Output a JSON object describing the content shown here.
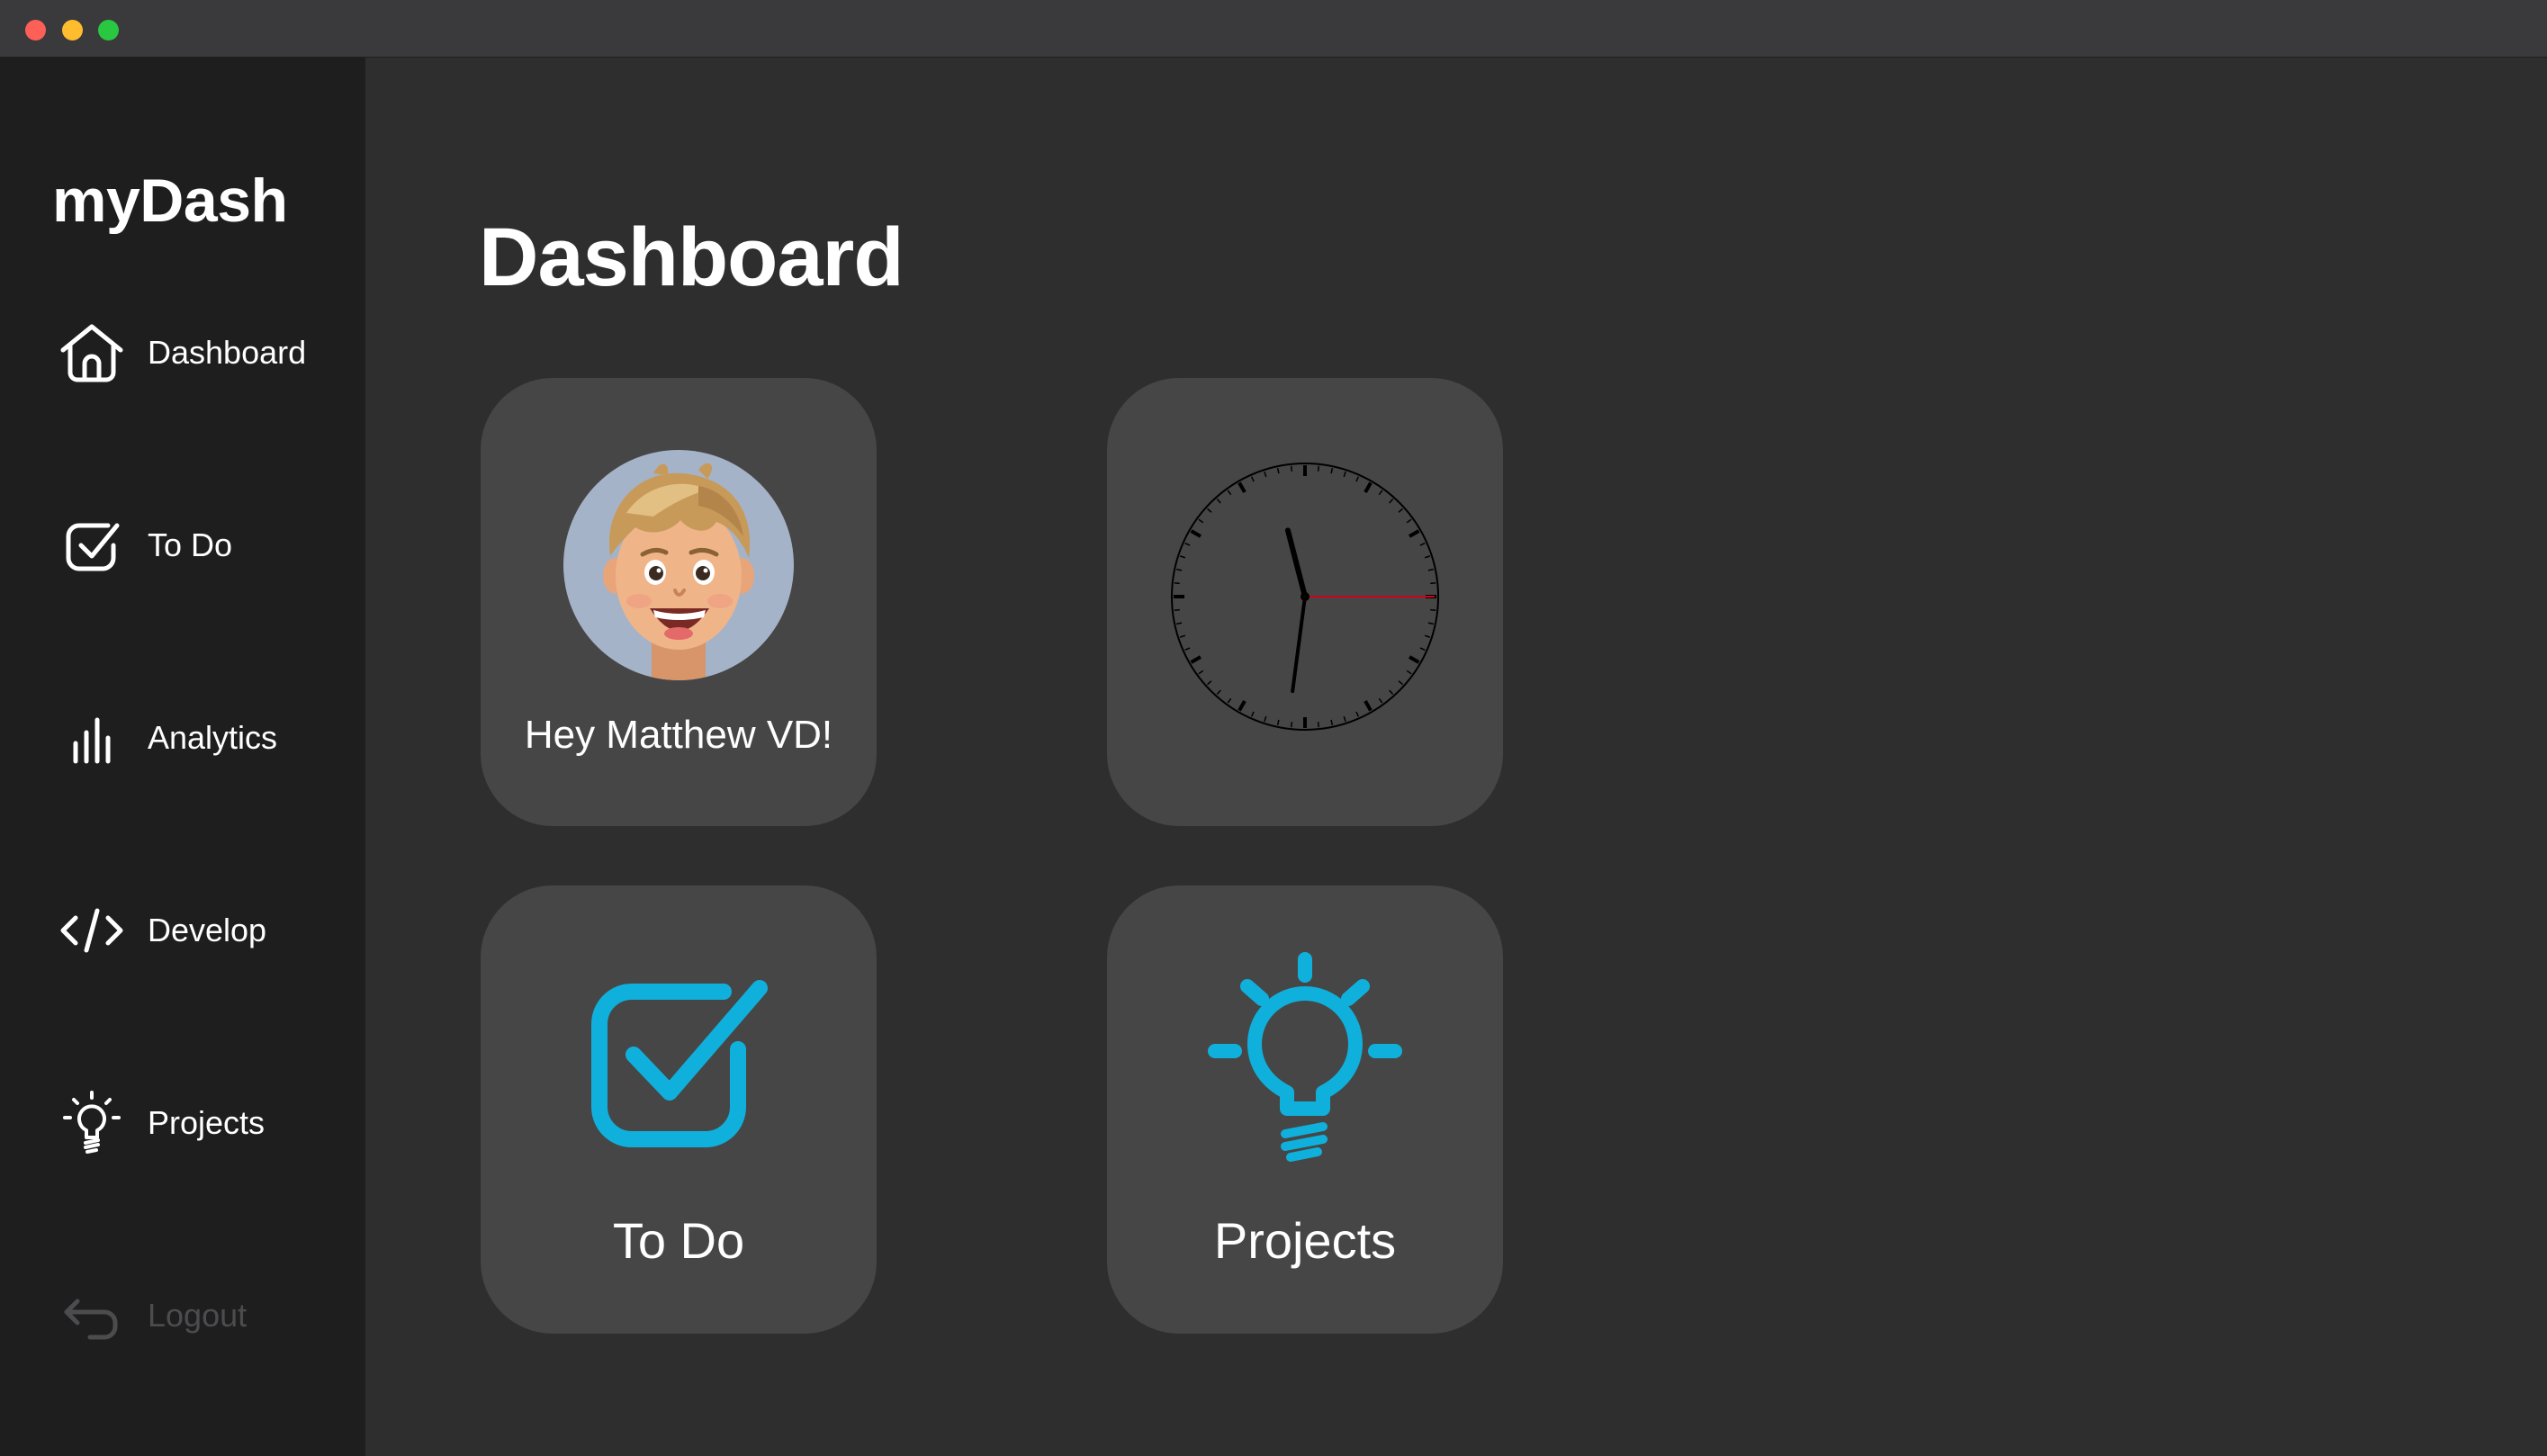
{
  "app": {
    "name": "myDash"
  },
  "window_controls": [
    "close",
    "minimize",
    "maximize"
  ],
  "sidebar": {
    "items": [
      {
        "label": "Dashboard",
        "icon": "house-icon"
      },
      {
        "label": "To Do",
        "icon": "checkbox-icon"
      },
      {
        "label": "Analytics",
        "icon": "bar-chart-icon"
      },
      {
        "label": "Develop",
        "icon": "code-icon"
      },
      {
        "label": "Projects",
        "icon": "lightbulb-icon"
      },
      {
        "label": "Logout",
        "icon": "return-arrow-icon",
        "disabled": true
      }
    ]
  },
  "main": {
    "title": "Dashboard",
    "cards": {
      "profile": {
        "greeting": "Hey Matthew VD!",
        "icon": "memoji-avatar"
      },
      "clock": {
        "icon": "analog-clock",
        "time": {
          "hour": 11,
          "minute": 31,
          "second": 15
        }
      },
      "todo": {
        "label": "To Do",
        "icon": "checkbox-icon"
      },
      "projects": {
        "label": "Projects",
        "icon": "lightbulb-icon"
      }
    }
  },
  "colors": {
    "accent": "#0fb1dc",
    "sidebar_bg": "#1e1e1f",
    "main_bg": "#2e2e2e",
    "card_bg": "#464646",
    "clock_second_hand": "#d0021b",
    "disabled_text": "#4c4c4e"
  }
}
